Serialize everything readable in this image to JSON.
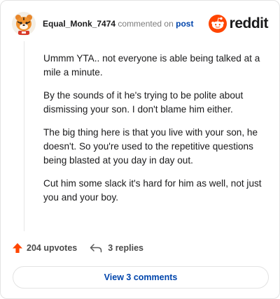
{
  "comment": {
    "username": "Equal_Monk_7474",
    "action_text": "commented on",
    "post_link": "post",
    "paragraphs": [
      "Ummm YTA.. not everyone is able being talked at a mile a minute.",
      "By the sounds of it he's trying to be polite about dismissing your son. I don't blame him either.",
      "The big thing here is that you live with your son, he doesn't. So you're used to the repetitive questions being blasted at you day in day out.",
      "Cut him some slack it's hard for him as well, not just you and your boy."
    ]
  },
  "brand": {
    "name": "reddit",
    "color": "#ff4500"
  },
  "footer": {
    "upvotes": "204 upvotes",
    "replies": "3 replies",
    "upvote_color": "#ff4500"
  },
  "view_comments_label": "View 3 comments",
  "icons": {
    "avatar": "tiger-avatar-icon",
    "logo": "reddit-snoo-icon",
    "upvote": "upvote-arrow-icon",
    "reply": "reply-arrow-icon"
  }
}
